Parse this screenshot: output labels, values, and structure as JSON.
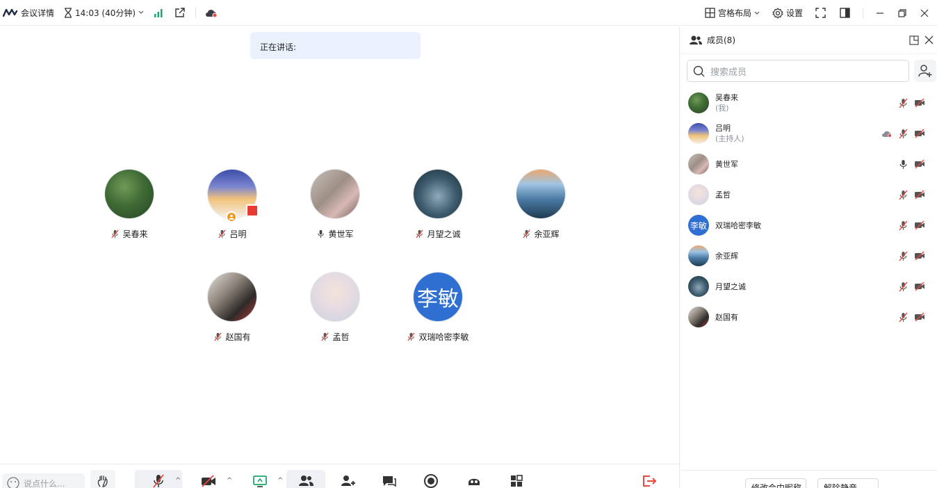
{
  "topbar": {
    "meeting_details": "会议详情",
    "timer": "14:03 (40分钟)",
    "layout_label": "宫格布局",
    "settings_label": "设置"
  },
  "stage": {
    "speaking_label": "正在讲话:",
    "participants": [
      {
        "name": "吴春来",
        "mic": "muted",
        "avatar": "forest"
      },
      {
        "name": "吕明",
        "mic": "muted",
        "avatar": "sky",
        "host": true
      },
      {
        "name": "黄世军",
        "mic": "on",
        "avatar": "photo"
      },
      {
        "name": "月望之诚",
        "mic": "muted",
        "avatar": "water"
      },
      {
        "name": "余亚辉",
        "mic": "muted",
        "avatar": "mountain"
      },
      {
        "name": "赵国有",
        "mic": "muted",
        "avatar": "drink"
      },
      {
        "name": "孟哲",
        "mic": "muted",
        "avatar": "girl"
      },
      {
        "name": "双瑞哈密李敏",
        "mic": "muted",
        "avatar": "text",
        "avatar_text": "李敏"
      }
    ]
  },
  "bottombar": {
    "chat_placeholder": "说点什么..."
  },
  "panel": {
    "title": "成员(8)",
    "search_placeholder": "搜索成员",
    "members": [
      {
        "name": "吴春来",
        "sub": "(我)",
        "avatar": "forest",
        "mic": "muted"
      },
      {
        "name": "吕明",
        "sub": "(主持人)",
        "avatar": "sky",
        "mic": "muted",
        "cloud": true
      },
      {
        "name": "黄世军",
        "sub": "",
        "avatar": "photo",
        "mic": "on"
      },
      {
        "name": "孟哲",
        "sub": "",
        "avatar": "girl",
        "mic": "muted"
      },
      {
        "name": "双瑞哈密李敏",
        "sub": "",
        "avatar": "text",
        "avatar_text": "李敏",
        "mic": "muted"
      },
      {
        "name": "余亚辉",
        "sub": "",
        "avatar": "mountain",
        "mic": "muted"
      },
      {
        "name": "月望之诚",
        "sub": "",
        "avatar": "water",
        "mic": "muted"
      },
      {
        "name": "赵国有",
        "sub": "",
        "avatar": "drink",
        "mic": "muted"
      }
    ],
    "footer_buttons": [
      "修改会中昵称",
      "解除静音"
    ]
  },
  "colors": {
    "accent_blue": "#2f6fd1",
    "speaking_bg": "#eaf1fd",
    "signal_green": "#1aa86b",
    "leave_red": "#e8473e"
  }
}
